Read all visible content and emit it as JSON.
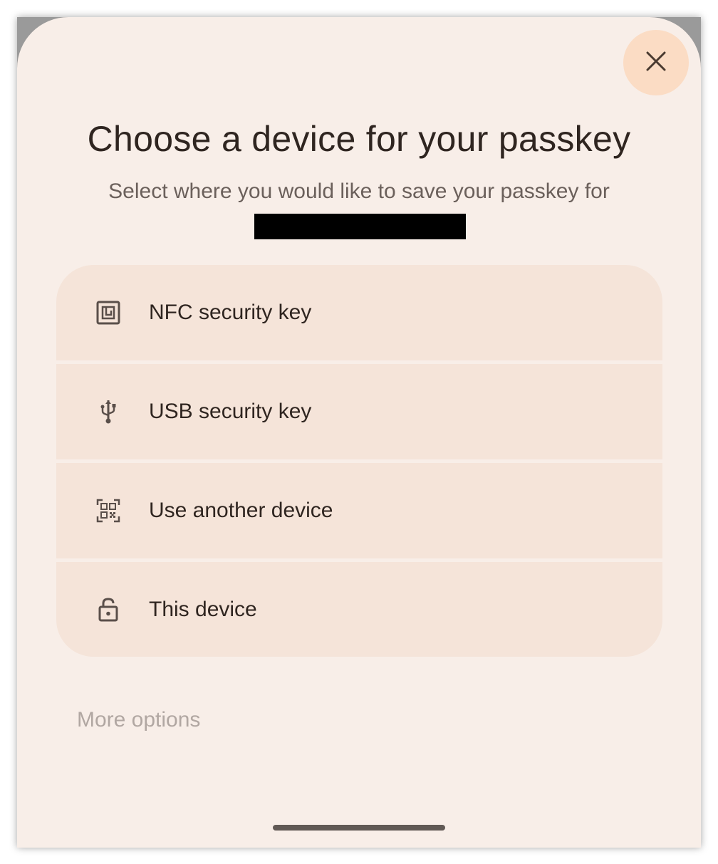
{
  "dialog": {
    "title": "Choose a device for your passkey",
    "subtitle": "Select where you would like to save your passkey for",
    "close_icon": "close-icon",
    "options": [
      {
        "label": "NFC security key",
        "icon": "nfc-icon"
      },
      {
        "label": "USB security key",
        "icon": "usb-icon"
      },
      {
        "label": "Use another device",
        "icon": "qr-code-icon"
      },
      {
        "label": "This device",
        "icon": "lock-open-icon"
      }
    ],
    "more_options": "More options"
  },
  "colors": {
    "sheet_bg": "#f8eee8",
    "option_bg": "#f5e4d9",
    "close_bg": "#fbdcc4",
    "text_primary": "#2f2520",
    "text_secondary": "#6b605b",
    "text_disabled": "#b1a7a2"
  }
}
